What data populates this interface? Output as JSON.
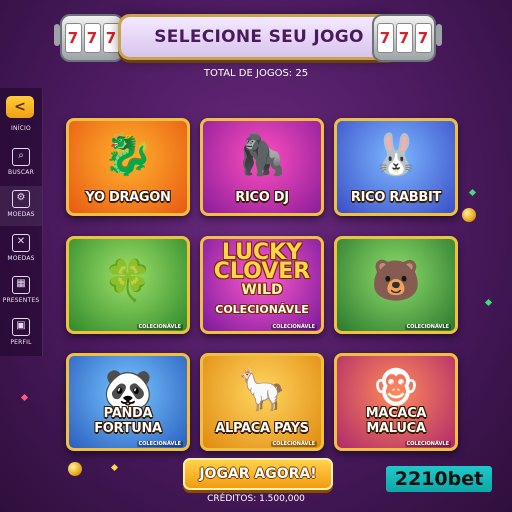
{
  "header": {
    "title": "SELECIONE SEU JOGO",
    "slot_icon": "slot-machine-icon",
    "slot_symbol": "7",
    "total_games": "TOTAL DE JOGOS: 25"
  },
  "sidebar": {
    "back_icon": "chevron-left-icon",
    "back_glyph": "<",
    "items": [
      {
        "label": "INÍCIO",
        "icon": "home-icon"
      },
      {
        "label": "BUSCAR",
        "icon": "search-icon"
      },
      {
        "label": "MOEDAS",
        "icon": "coins-icon"
      },
      {
        "label": "MOEDAS",
        "icon": "tickets-icon"
      },
      {
        "label": "PRESENTES",
        "icon": "gift-icon"
      },
      {
        "label": "PERFIL",
        "icon": "profile-icon"
      }
    ]
  },
  "games": [
    {
      "title": "YO DRAGON",
      "art": "dragon",
      "badge": ""
    },
    {
      "title": "RICO DJ",
      "art": "gorilla-dj",
      "badge": ""
    },
    {
      "title": "RICO RABBIT",
      "art": "rabbit",
      "badge": ""
    },
    {
      "title": "",
      "art": "leprechaun",
      "badge": "COLECIONÁVLE"
    },
    {
      "title": "",
      "art": "lucky-clover-logo",
      "badge": "COLECIONÁVLE",
      "big_lines": [
        "LUCKY",
        "CLOVER",
        "WILD",
        "COLECIONÁVLE"
      ]
    },
    {
      "title": "",
      "art": "bear",
      "badge": "COLECIONÁVLE"
    },
    {
      "title": "PANDA FORTUNA",
      "art": "panda",
      "badge": "COLECIONÁVLE"
    },
    {
      "title": "ALPACA PAYS",
      "art": "alpaca",
      "badge": "COLECIONÁVLE"
    },
    {
      "title": "MACACA MALUCA",
      "art": "monkey",
      "badge": "COLECIONÁVLE"
    }
  ],
  "cta": {
    "label": "JOGAR AGORA!"
  },
  "credits": "CRÉDITOS: 1.500,000",
  "brand": "2210bet",
  "colors": {
    "accent_gold": "#f0c040",
    "background": "#4a1a5e",
    "brand_teal": "#1fc9c9"
  }
}
